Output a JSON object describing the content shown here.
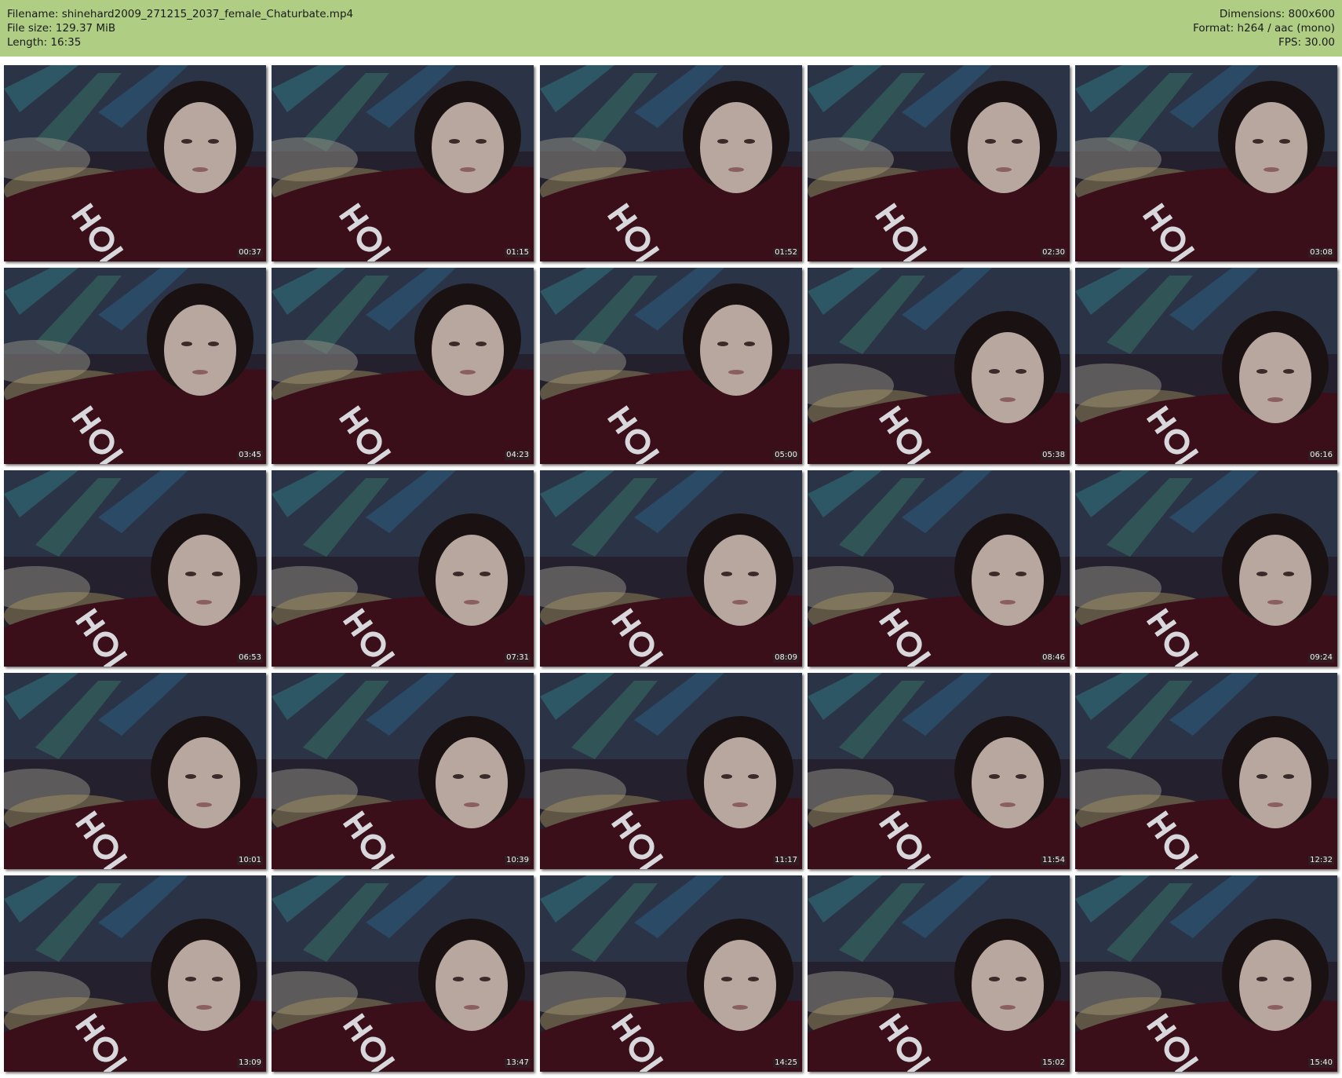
{
  "header": {
    "filename_line": "Filename: shinehard2009_271215_2037_female_Chaturbate.mp4",
    "filesize_line": "File size: 129.37 MiB",
    "length_line": "Length: 16:35",
    "dimensions_line": "Dimensions: 800x600",
    "format_line": "Format: h264 / aac (mono)",
    "fps_line": "FPS: 30.00"
  },
  "colors": {
    "header_bg": "#b0ce83",
    "page_bg": "#ffffff"
  },
  "thumbnails": [
    {
      "timestamp": "00:37"
    },
    {
      "timestamp": "01:15"
    },
    {
      "timestamp": "01:52"
    },
    {
      "timestamp": "02:30"
    },
    {
      "timestamp": "03:08"
    },
    {
      "timestamp": "03:45"
    },
    {
      "timestamp": "04:23"
    },
    {
      "timestamp": "05:00"
    },
    {
      "timestamp": "05:38"
    },
    {
      "timestamp": "06:16"
    },
    {
      "timestamp": "06:53"
    },
    {
      "timestamp": "07:31"
    },
    {
      "timestamp": "08:09"
    },
    {
      "timestamp": "08:46"
    },
    {
      "timestamp": "09:24"
    },
    {
      "timestamp": "10:01"
    },
    {
      "timestamp": "10:39"
    },
    {
      "timestamp": "11:17"
    },
    {
      "timestamp": "11:54"
    },
    {
      "timestamp": "12:32"
    },
    {
      "timestamp": "13:09"
    },
    {
      "timestamp": "13:47"
    },
    {
      "timestamp": "14:25"
    },
    {
      "timestamp": "15:02"
    },
    {
      "timestamp": "15:40"
    }
  ]
}
